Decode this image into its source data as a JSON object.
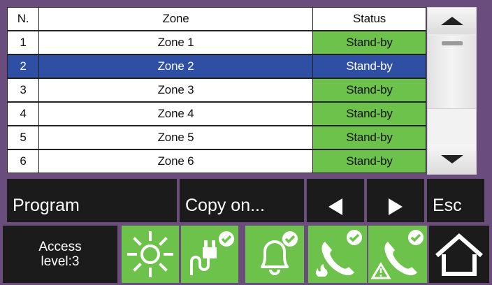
{
  "table": {
    "headers": {
      "number": "N.",
      "zone": "Zone",
      "status": "Status"
    },
    "rows": [
      {
        "number": "1",
        "zone": "Zone 1",
        "status": "Stand-by",
        "selected": false
      },
      {
        "number": "2",
        "zone": "Zone 2",
        "status": "Stand-by",
        "selected": true
      },
      {
        "number": "3",
        "zone": "Zone 3",
        "status": "Stand-by",
        "selected": false
      },
      {
        "number": "4",
        "zone": "Zone 4",
        "status": "Stand-by",
        "selected": false
      },
      {
        "number": "5",
        "zone": "Zone 5",
        "status": "Stand-by",
        "selected": false
      },
      {
        "number": "6",
        "zone": "Zone 6",
        "status": "Stand-by",
        "selected": false
      }
    ]
  },
  "actions": {
    "program": "Program",
    "copy_on": "Copy on...",
    "esc": "Esc",
    "prev_icon": "left-triangle-icon",
    "next_icon": "right-triangle-icon"
  },
  "access": {
    "line1": "Access",
    "line2": "level:3"
  },
  "status_icons": [
    {
      "name": "sun-icon",
      "color": "#6cc24a"
    },
    {
      "name": "power-plug-check-icon",
      "color": "#6cc24a"
    },
    {
      "name": "bell-check-icon",
      "color": "#6cc24a"
    },
    {
      "name": "phone-fire-check-icon",
      "color": "#6cc24a"
    },
    {
      "name": "phone-warning-check-icon",
      "color": "#6cc24a"
    },
    {
      "name": "home-icon",
      "color": "#1b1b1b"
    }
  ],
  "colors": {
    "background": "#6b4d7d",
    "standby": "#6cc24a",
    "selected": "#2e4fa3",
    "button": "#1b1b1b"
  }
}
